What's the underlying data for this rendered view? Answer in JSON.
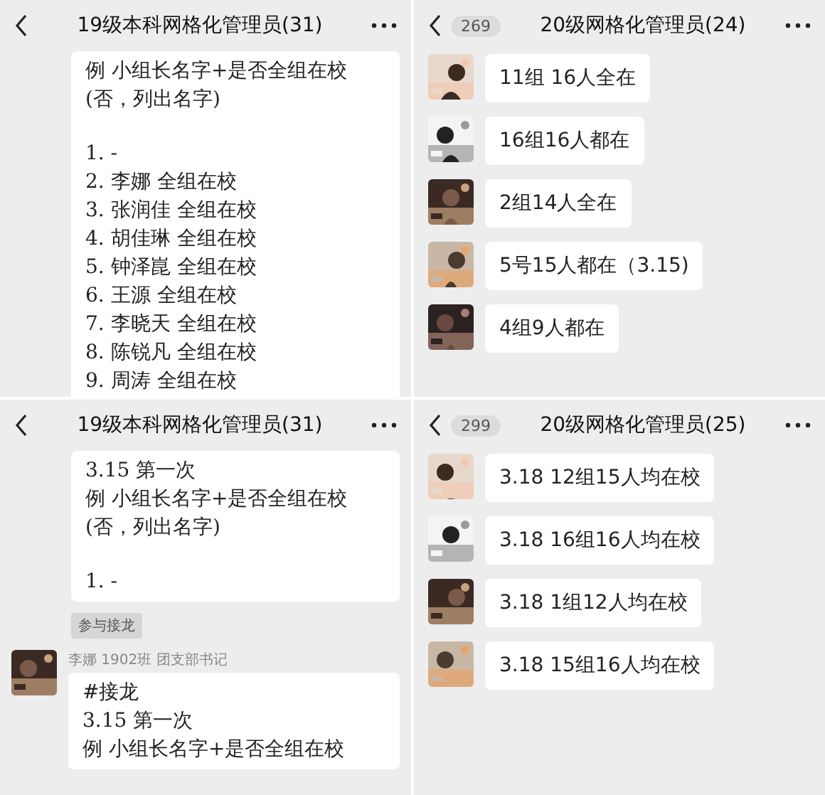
{
  "panels": [
    {
      "header": {
        "title": "19级本科网格化管理员(31)"
      },
      "items": [
        {
          "kind": "bubble",
          "paragraphs": [
            [
              "例 小组长名字+是否全组在校",
              "(否，列出名字)"
            ],
            [
              "1. -",
              "2. 李娜 全组在校",
              "3. 张润佳  全组在校",
              "4. 胡佳琳  全组在校",
              "5. 钟泽崑 全组在校",
              "6. 王源 全组在校",
              "7. 李晓天 全组在校",
              "8. 陈锐凡 全组在校",
              "9. 周涛 全组在校"
            ]
          ]
        }
      ]
    },
    {
      "header": {
        "title": "20级网格化管理员(24)",
        "unread": "269"
      },
      "items": [
        {
          "kind": "message",
          "paragraphs": [
            [
              "11组 16人全在"
            ]
          ]
        },
        {
          "kind": "message",
          "paragraphs": [
            [
              "16组16人都在"
            ]
          ]
        },
        {
          "kind": "message",
          "paragraphs": [
            [
              "2组14人全在"
            ]
          ]
        },
        {
          "kind": "message",
          "paragraphs": [
            [
              "5号15人都在（3.15)"
            ]
          ]
        },
        {
          "kind": "message",
          "paragraphs": [
            [
              "4组9人都在"
            ]
          ]
        }
      ]
    },
    {
      "header": {
        "title": "19级本科网格化管理员(31)"
      },
      "items": [
        {
          "kind": "bubble",
          "paragraphs": [
            [
              "3.15 第一次",
              "例 小组长名字+是否全组在校",
              "(否，列出名字)"
            ],
            [
              "1. -"
            ]
          ]
        },
        {
          "kind": "tag",
          "text": "参与接龙"
        },
        {
          "kind": "message",
          "sender": "李娜 1902班 团支部书记",
          "paragraphs": [
            [
              "#接龙",
              "3.15 第一次",
              "例 小组长名字+是否全组在校"
            ]
          ]
        }
      ]
    },
    {
      "header": {
        "title": "20级网格化管理员(25)",
        "unread": "299"
      },
      "items": [
        {
          "kind": "message",
          "paragraphs": [
            [
              "3.18 12组15人均在校"
            ]
          ]
        },
        {
          "kind": "message",
          "paragraphs": [
            [
              "3.18 16组16人均在校"
            ]
          ]
        },
        {
          "kind": "message",
          "paragraphs": [
            [
              "3.18 1组12人均在校"
            ]
          ]
        },
        {
          "kind": "message",
          "paragraphs": [
            [
              "3.18 15组16人均在校"
            ]
          ]
        }
      ]
    }
  ]
}
